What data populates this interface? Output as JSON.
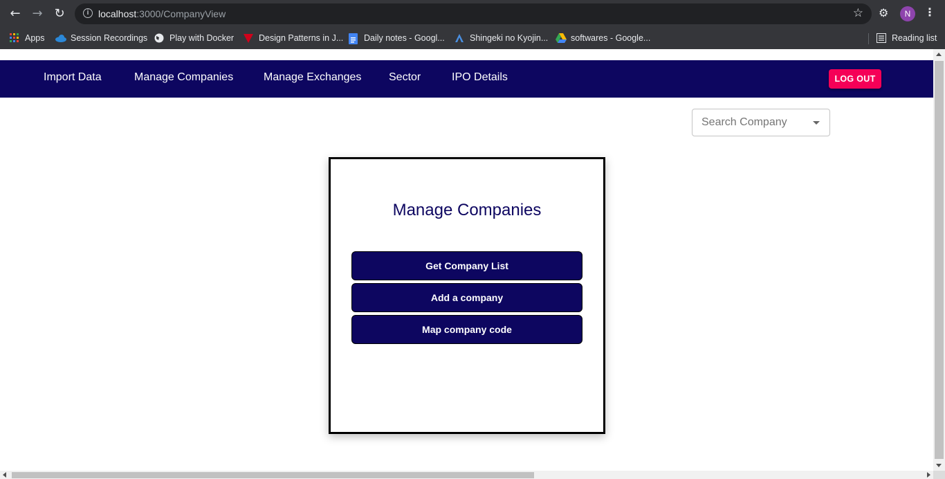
{
  "browser": {
    "url_host": "localhost",
    "url_path": ":3000/CompanyView",
    "profile_initial": "N",
    "icons": {
      "back": "back-arrow-icon",
      "forward": "forward-arrow-icon",
      "reload": "reload-icon",
      "info": "info-icon",
      "star": "star-icon",
      "extensions": "puzzle-icon",
      "menu": "kebab-menu-icon"
    },
    "bookmarks": [
      {
        "label": "Apps",
        "icon": "apps-grid-icon"
      },
      {
        "label": "Session Recordings",
        "icon": "cloud-icon"
      },
      {
        "label": "Play with Docker",
        "icon": "globe-icon"
      },
      {
        "label": "Design Patterns in J...",
        "icon": "triangle-logo-icon"
      },
      {
        "label": "Daily notes - Googl...",
        "icon": "docs-icon"
      },
      {
        "label": "Shingeki no Kyojin...",
        "icon": "letter-a-icon"
      },
      {
        "label": "softwares - Google...",
        "icon": "drive-icon"
      }
    ],
    "reading_list": "Reading list"
  },
  "appbar": {
    "links": [
      "Import Data",
      "Manage Companies",
      "Manage Exchanges",
      "Sector",
      "IPO Details"
    ],
    "logout_label": "LOG OUT"
  },
  "search": {
    "placeholder": "Search Company"
  },
  "card": {
    "title": "Manage Companies",
    "buttons": [
      "Get Company List",
      "Add a company",
      "Map company code"
    ]
  },
  "colors": {
    "appbar_bg": "#0d0660",
    "logout_bg": "#f50057",
    "button_bg": "#0d0660"
  }
}
